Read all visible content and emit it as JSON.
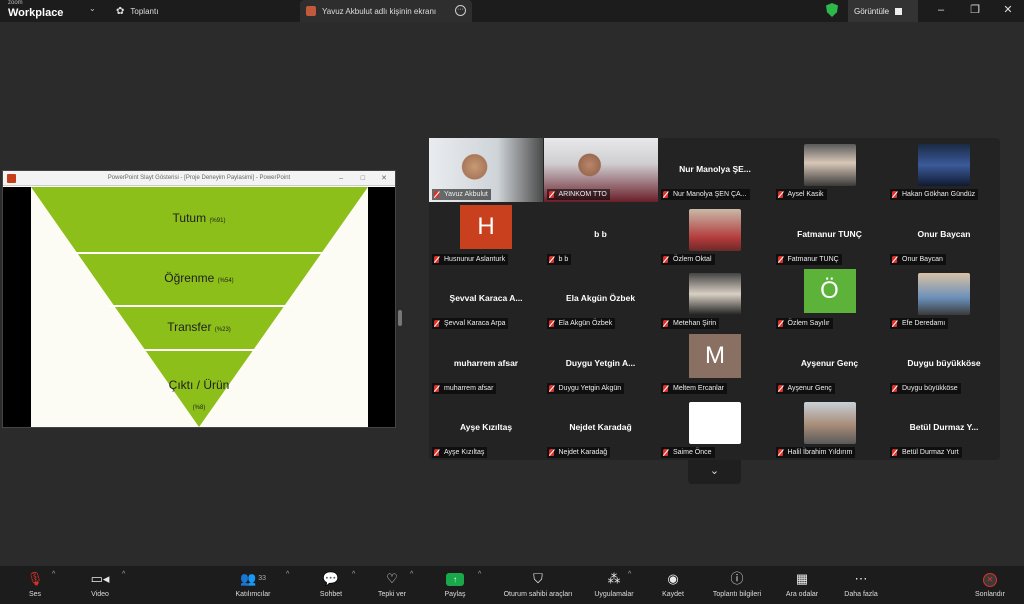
{
  "window": {
    "brand_small": "zoom",
    "brand_big": "Workplace",
    "tab_meeting": "Toplantı",
    "tab_share": "Yavuz Akbulut adlı kişinin ekranı",
    "view_label": "Görüntüle"
  },
  "ppt": {
    "title": "PowerPoint Slayt Gösterisi - [Proje Deneyim Paylasimi] - PowerPoint",
    "levels": [
      {
        "label": "Tutum",
        "pct": "(%91)"
      },
      {
        "label": "Öğrenme",
        "pct": "(%54)"
      },
      {
        "label": "Transfer",
        "pct": "(%23)"
      },
      {
        "label": "Çıktı / Ürün",
        "pct": "(%8)"
      }
    ],
    "accent": "#8cbf1a"
  },
  "participants": [
    {
      "label": "Yavuz Akbulut",
      "kind": "video",
      "active": true
    },
    {
      "label": "ARINKOM TTO",
      "kind": "video"
    },
    {
      "label": "Nur Manolya ŞEN ÇA...",
      "name": "Nur Manolya ŞE...",
      "kind": "name"
    },
    {
      "label": "Aysel Kasik",
      "kind": "photo"
    },
    {
      "label": "Hakan Gökhan Gündüz",
      "kind": "photo"
    },
    {
      "label": "Husnunur Aslanturk",
      "kind": "letter",
      "letter": "H",
      "color": "#c8401e"
    },
    {
      "label": "b b",
      "name": "b b",
      "kind": "name"
    },
    {
      "label": "Özlem Oktal",
      "kind": "photo"
    },
    {
      "label": "Fatmanur TUNÇ",
      "name": "Fatmanur TUNÇ",
      "kind": "name"
    },
    {
      "label": "Onur Baycan",
      "name": "Onur Baycan",
      "kind": "name"
    },
    {
      "label": "Şevval Karaca Arpa",
      "name": "Şevval Karaca A...",
      "kind": "name"
    },
    {
      "label": "Ela Akgün Özbek",
      "name": "Ela Akgün Özbek",
      "kind": "name"
    },
    {
      "label": "Metehan Şirin",
      "kind": "photo"
    },
    {
      "label": "Özlem Sayılır",
      "kind": "letter",
      "letter": "Ö",
      "color": "#5db33a"
    },
    {
      "label": "Efe Deredamı",
      "kind": "photo"
    },
    {
      "label": "muharrem afsar",
      "name": "muharrem afsar",
      "kind": "name"
    },
    {
      "label": "Duygu Yetgin Akgün",
      "name": "Duygu Yetgin A...",
      "kind": "name"
    },
    {
      "label": "Meltem Ercanlar",
      "kind": "letter",
      "letter": "M",
      "color": "#8a6f63"
    },
    {
      "label": "Ayşenur Genç",
      "name": "Ayşenur Genç",
      "kind": "name"
    },
    {
      "label": "Duygu büyükköse",
      "name": "Duygu büyükköse",
      "kind": "name"
    },
    {
      "label": "Ayşe Kızıltaş",
      "name": "Ayşe Kızıltaş",
      "kind": "name"
    },
    {
      "label": "Nejdet Karadağ",
      "name": "Nejdet Karadağ",
      "kind": "name"
    },
    {
      "label": "Saime Önce",
      "kind": "blank"
    },
    {
      "label": "Halil İbrahim Yıldırım",
      "kind": "photo"
    },
    {
      "label": "Betül Durmaz Yurt",
      "name": "Betül Durmaz Y...",
      "kind": "name"
    }
  ],
  "toolbar": {
    "audio": "Ses",
    "video": "Video",
    "participants": "Katılımcılar",
    "participants_count": "33",
    "chat": "Sohbet",
    "react": "Tepki ver",
    "share": "Paylaş",
    "host_tools": "Oturum sahibi araçları",
    "apps": "Uygulamalar",
    "record": "Kaydet",
    "info": "Toplantı bilgileri",
    "rooms": "Ara odalar",
    "more": "Daha fazla",
    "end": "Sonlandır"
  }
}
